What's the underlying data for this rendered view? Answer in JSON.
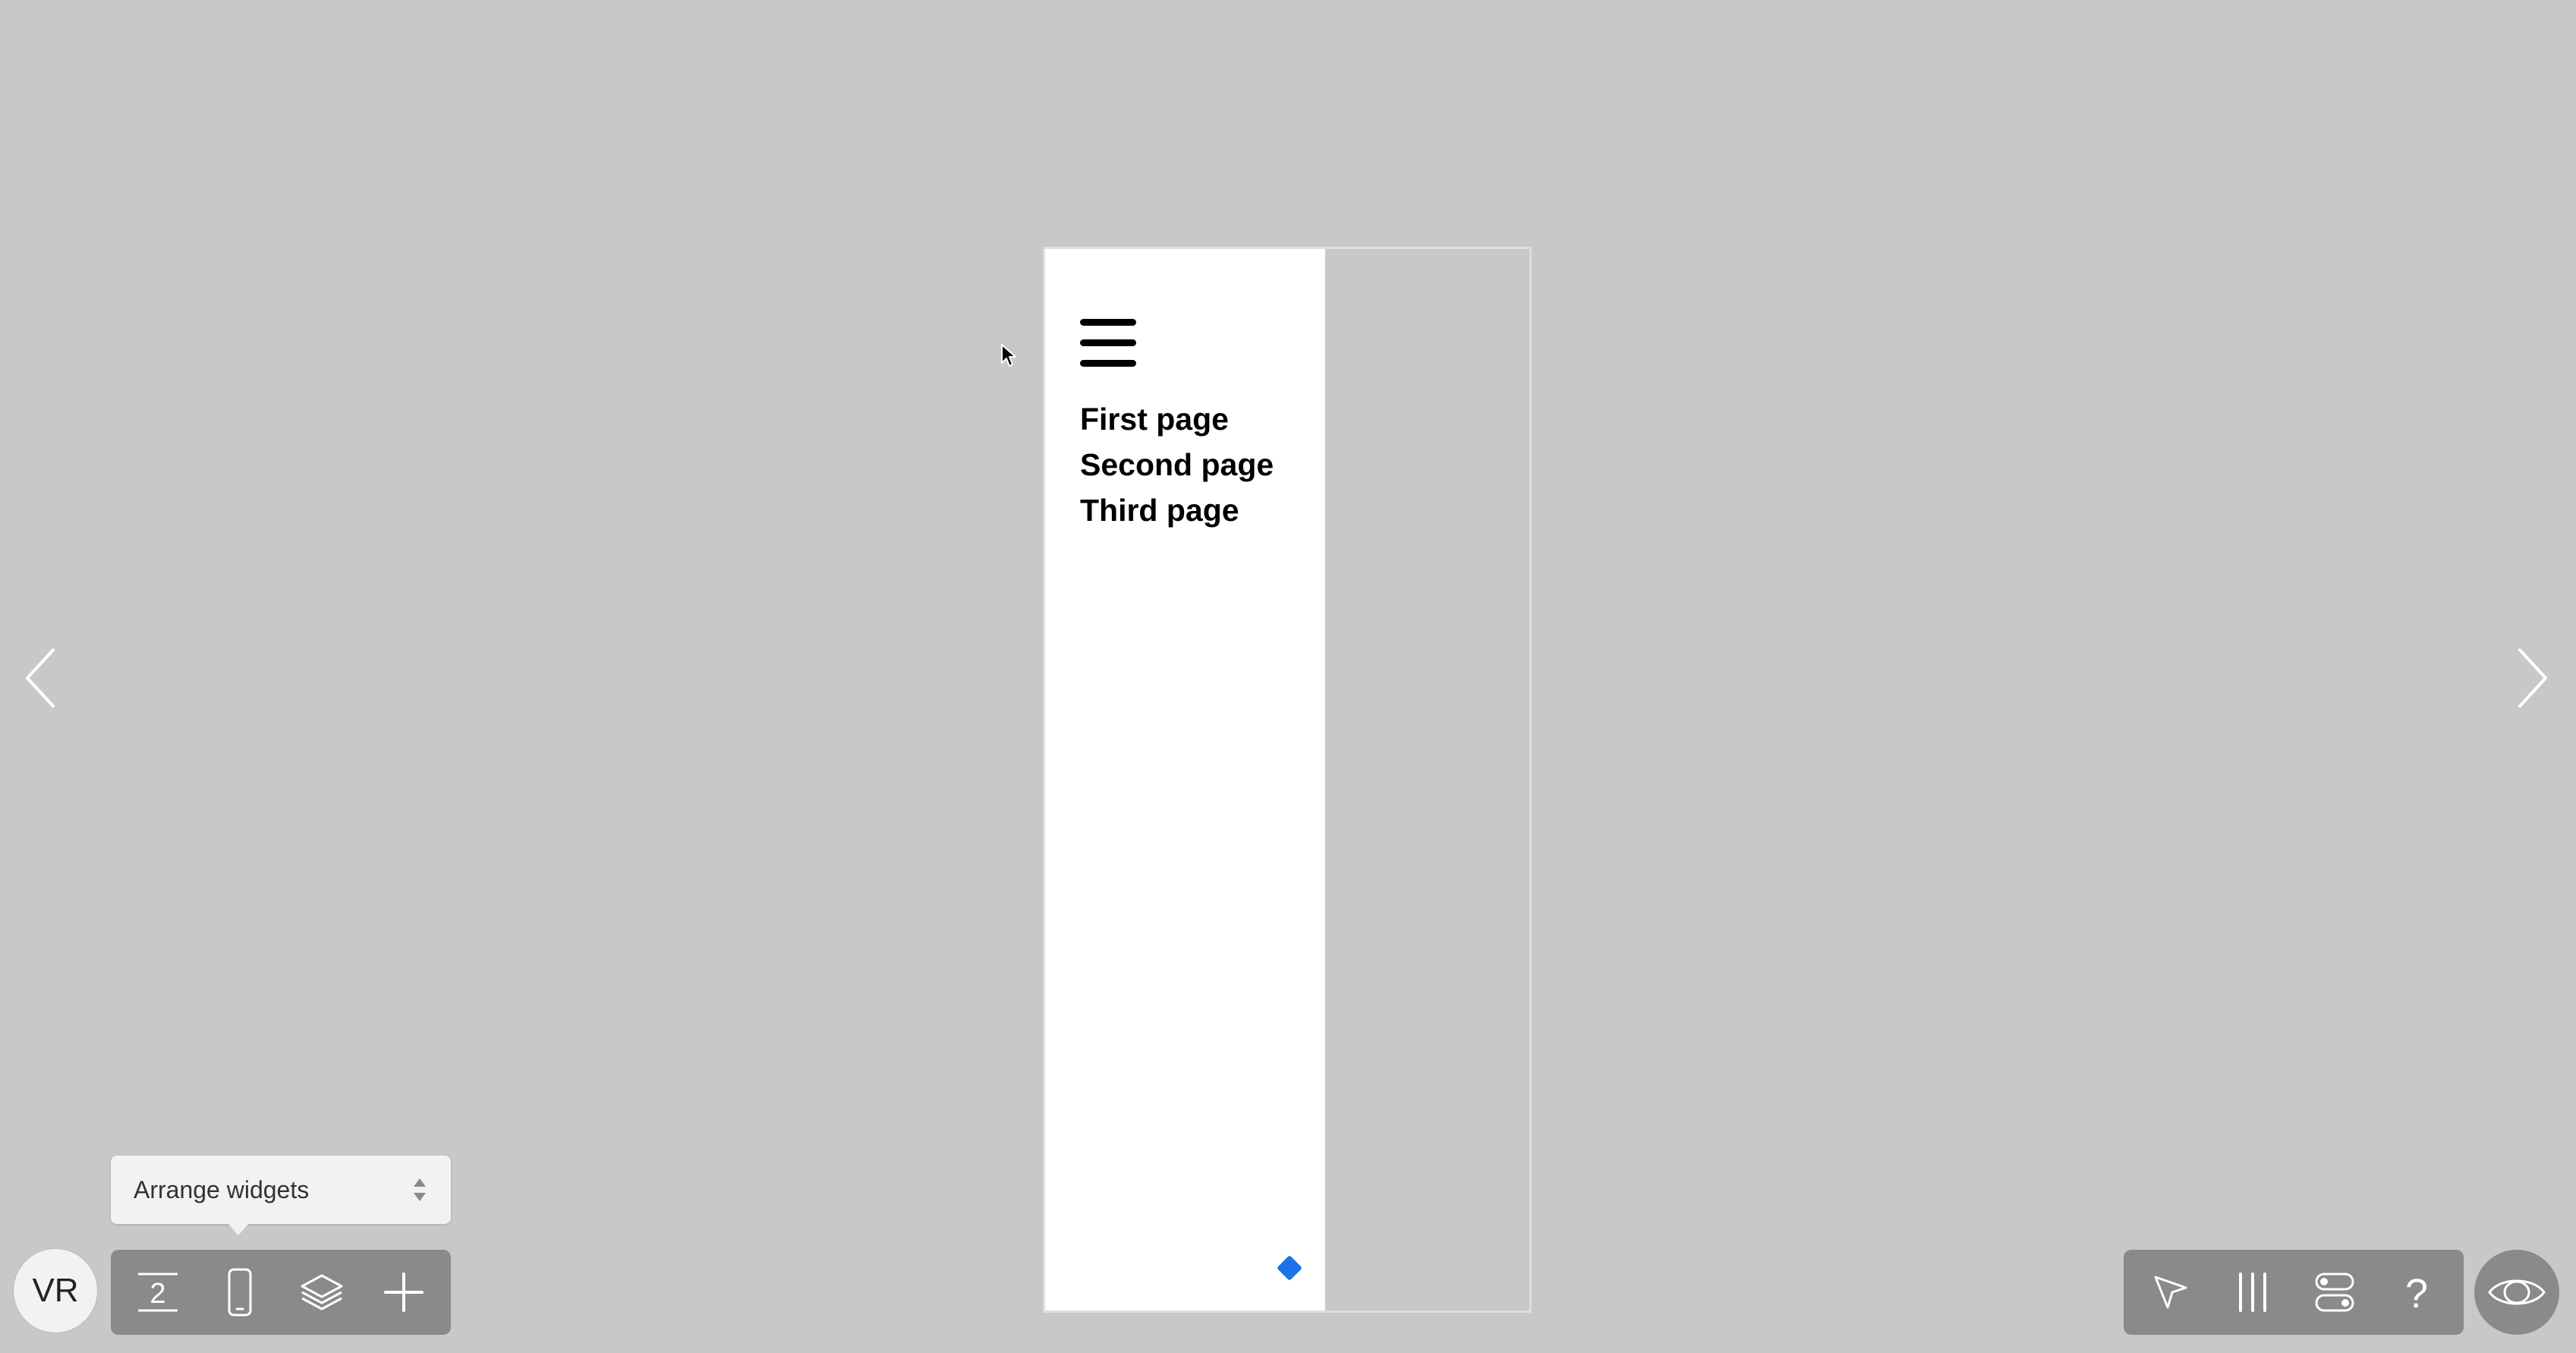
{
  "drawer": {
    "menu_items": [
      {
        "label": "First page"
      },
      {
        "label": "Second page"
      },
      {
        "label": "Third page"
      }
    ],
    "accent_color": "#1a73e8"
  },
  "user": {
    "initials": "VR"
  },
  "arrange_popover": {
    "label": "Arrange widgets"
  },
  "toolbar_left": {
    "icons": [
      "page-count-icon",
      "phone-device-icon",
      "layers-icon",
      "add-icon"
    ],
    "page_count": "2"
  },
  "toolbar_right": {
    "icons": [
      "select-pointer-icon",
      "columns-icon",
      "toggles-icon",
      "help-icon"
    ],
    "help_glyph": "?"
  },
  "preview": {
    "icon": "eye-icon"
  },
  "navigation": {
    "prev_icon": "chevron-left-icon",
    "next_icon": "chevron-right-icon"
  }
}
